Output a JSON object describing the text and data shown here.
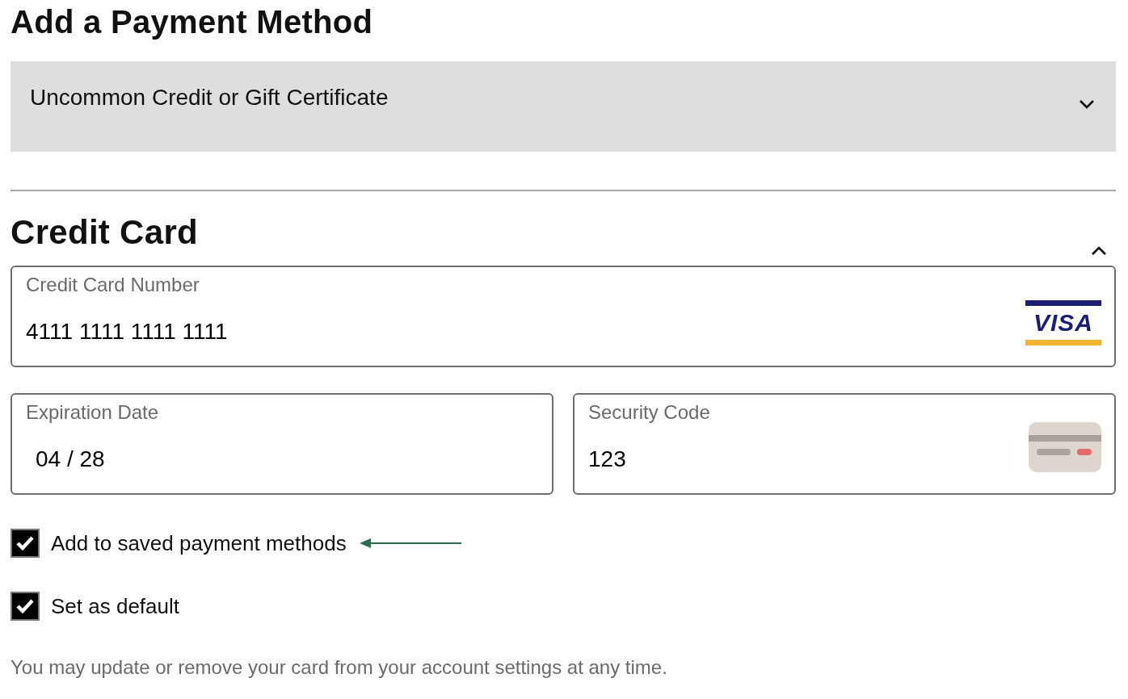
{
  "title": "Add a Payment Method",
  "gift_section": {
    "label": "Uncommon Credit or Gift Certificate",
    "expanded": false
  },
  "card_section": {
    "title": "Credit Card",
    "expanded": true
  },
  "fields": [
    {
      "kind": "number",
      "label": "Credit Card Number",
      "value": "4111 1111 1111 1111",
      "brand": "VISA"
    },
    {
      "kind": "expiry",
      "label": "Expiration Date",
      "value": "04 / 28"
    },
    {
      "kind": "cvc",
      "label": "Security Code",
      "value": "123"
    }
  ],
  "checkboxes": [
    {
      "label": "Add to saved payment methods",
      "checked": true,
      "pointer": true
    },
    {
      "label": "Set as default",
      "checked": true,
      "pointer": false
    }
  ],
  "note": "You may update or remove your card from your account settings at any time."
}
